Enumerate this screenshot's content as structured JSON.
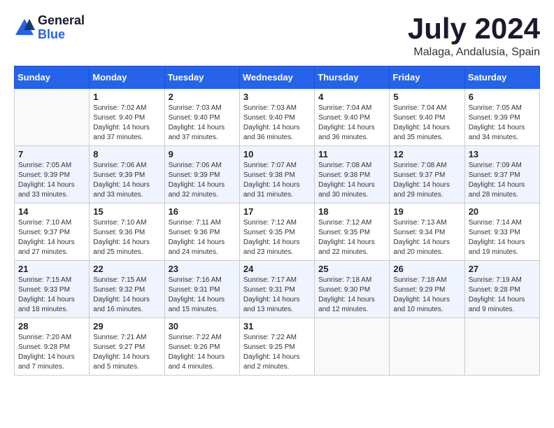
{
  "logo": {
    "general": "General",
    "blue": "Blue"
  },
  "title": "July 2024",
  "location": "Malaga, Andalusia, Spain",
  "days_of_week": [
    "Sunday",
    "Monday",
    "Tuesday",
    "Wednesday",
    "Thursday",
    "Friday",
    "Saturday"
  ],
  "weeks": [
    [
      {
        "day": "",
        "info": ""
      },
      {
        "day": "1",
        "info": "Sunrise: 7:02 AM\nSunset: 9:40 PM\nDaylight: 14 hours\nand 37 minutes."
      },
      {
        "day": "2",
        "info": "Sunrise: 7:03 AM\nSunset: 9:40 PM\nDaylight: 14 hours\nand 37 minutes."
      },
      {
        "day": "3",
        "info": "Sunrise: 7:03 AM\nSunset: 9:40 PM\nDaylight: 14 hours\nand 36 minutes."
      },
      {
        "day": "4",
        "info": "Sunrise: 7:04 AM\nSunset: 9:40 PM\nDaylight: 14 hours\nand 36 minutes."
      },
      {
        "day": "5",
        "info": "Sunrise: 7:04 AM\nSunset: 9:40 PM\nDaylight: 14 hours\nand 35 minutes."
      },
      {
        "day": "6",
        "info": "Sunrise: 7:05 AM\nSunset: 9:39 PM\nDaylight: 14 hours\nand 34 minutes."
      }
    ],
    [
      {
        "day": "7",
        "info": "Sunrise: 7:05 AM\nSunset: 9:39 PM\nDaylight: 14 hours\nand 33 minutes."
      },
      {
        "day": "8",
        "info": "Sunrise: 7:06 AM\nSunset: 9:39 PM\nDaylight: 14 hours\nand 33 minutes."
      },
      {
        "day": "9",
        "info": "Sunrise: 7:06 AM\nSunset: 9:39 PM\nDaylight: 14 hours\nand 32 minutes."
      },
      {
        "day": "10",
        "info": "Sunrise: 7:07 AM\nSunset: 9:38 PM\nDaylight: 14 hours\nand 31 minutes."
      },
      {
        "day": "11",
        "info": "Sunrise: 7:08 AM\nSunset: 9:38 PM\nDaylight: 14 hours\nand 30 minutes."
      },
      {
        "day": "12",
        "info": "Sunrise: 7:08 AM\nSunset: 9:37 PM\nDaylight: 14 hours\nand 29 minutes."
      },
      {
        "day": "13",
        "info": "Sunrise: 7:09 AM\nSunset: 9:37 PM\nDaylight: 14 hours\nand 28 minutes."
      }
    ],
    [
      {
        "day": "14",
        "info": "Sunrise: 7:10 AM\nSunset: 9:37 PM\nDaylight: 14 hours\nand 27 minutes."
      },
      {
        "day": "15",
        "info": "Sunrise: 7:10 AM\nSunset: 9:36 PM\nDaylight: 14 hours\nand 25 minutes."
      },
      {
        "day": "16",
        "info": "Sunrise: 7:11 AM\nSunset: 9:36 PM\nDaylight: 14 hours\nand 24 minutes."
      },
      {
        "day": "17",
        "info": "Sunrise: 7:12 AM\nSunset: 9:35 PM\nDaylight: 14 hours\nand 23 minutes."
      },
      {
        "day": "18",
        "info": "Sunrise: 7:12 AM\nSunset: 9:35 PM\nDaylight: 14 hours\nand 22 minutes."
      },
      {
        "day": "19",
        "info": "Sunrise: 7:13 AM\nSunset: 9:34 PM\nDaylight: 14 hours\nand 20 minutes."
      },
      {
        "day": "20",
        "info": "Sunrise: 7:14 AM\nSunset: 9:33 PM\nDaylight: 14 hours\nand 19 minutes."
      }
    ],
    [
      {
        "day": "21",
        "info": "Sunrise: 7:15 AM\nSunset: 9:33 PM\nDaylight: 14 hours\nand 18 minutes."
      },
      {
        "day": "22",
        "info": "Sunrise: 7:15 AM\nSunset: 9:32 PM\nDaylight: 14 hours\nand 16 minutes."
      },
      {
        "day": "23",
        "info": "Sunrise: 7:16 AM\nSunset: 9:31 PM\nDaylight: 14 hours\nand 15 minutes."
      },
      {
        "day": "24",
        "info": "Sunrise: 7:17 AM\nSunset: 9:31 PM\nDaylight: 14 hours\nand 13 minutes."
      },
      {
        "day": "25",
        "info": "Sunrise: 7:18 AM\nSunset: 9:30 PM\nDaylight: 14 hours\nand 12 minutes."
      },
      {
        "day": "26",
        "info": "Sunrise: 7:18 AM\nSunset: 9:29 PM\nDaylight: 14 hours\nand 10 minutes."
      },
      {
        "day": "27",
        "info": "Sunrise: 7:19 AM\nSunset: 9:28 PM\nDaylight: 14 hours\nand 9 minutes."
      }
    ],
    [
      {
        "day": "28",
        "info": "Sunrise: 7:20 AM\nSunset: 9:28 PM\nDaylight: 14 hours\nand 7 minutes."
      },
      {
        "day": "29",
        "info": "Sunrise: 7:21 AM\nSunset: 9:27 PM\nDaylight: 14 hours\nand 5 minutes."
      },
      {
        "day": "30",
        "info": "Sunrise: 7:22 AM\nSunset: 9:26 PM\nDaylight: 14 hours\nand 4 minutes."
      },
      {
        "day": "31",
        "info": "Sunrise: 7:22 AM\nSunset: 9:25 PM\nDaylight: 14 hours\nand 2 minutes."
      },
      {
        "day": "",
        "info": ""
      },
      {
        "day": "",
        "info": ""
      },
      {
        "day": "",
        "info": ""
      }
    ]
  ]
}
